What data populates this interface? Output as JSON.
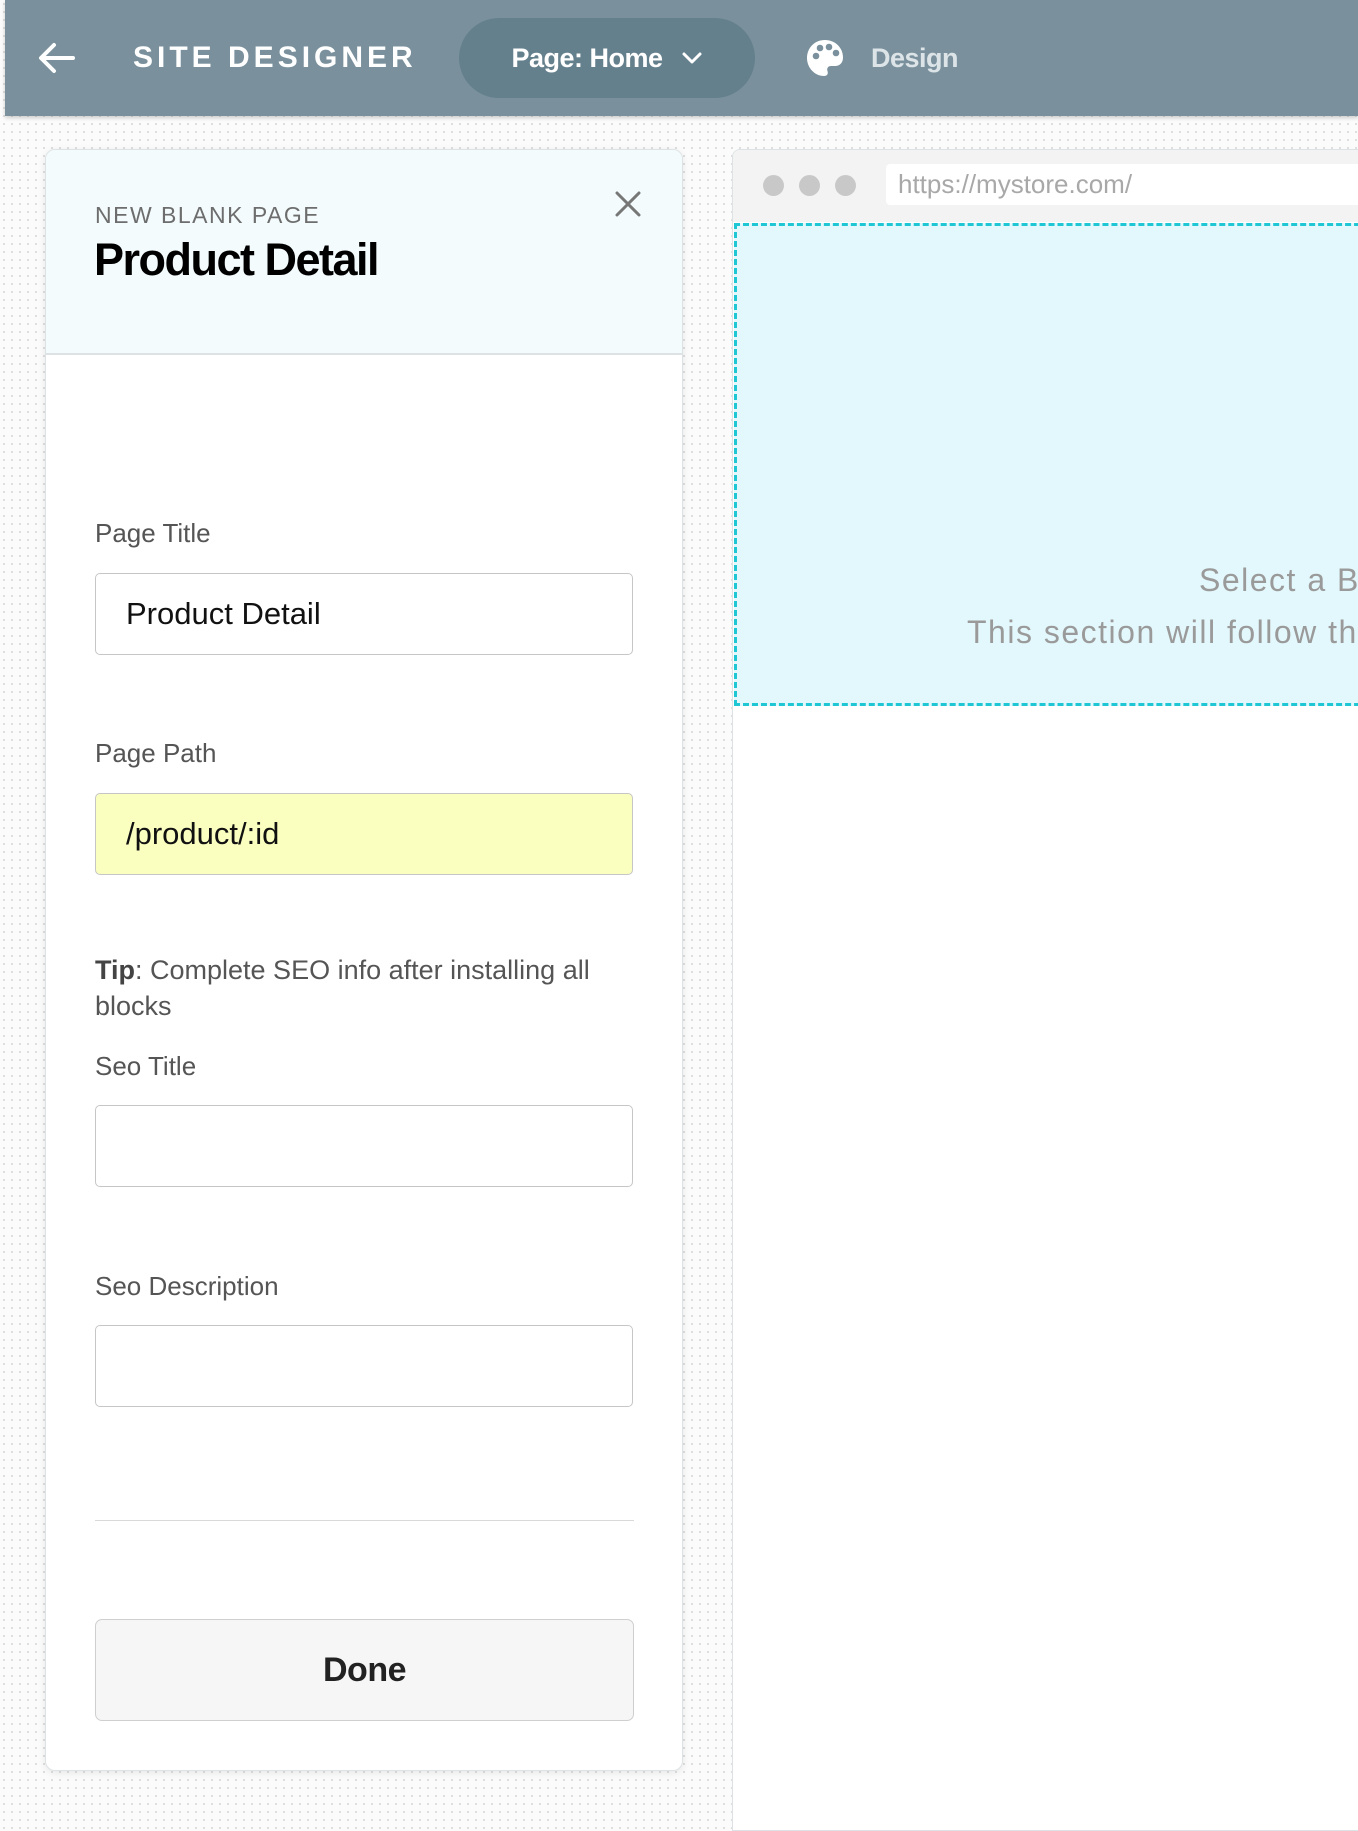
{
  "topbar": {
    "back_icon": "arrow-left-icon",
    "app_title": "SITE DESIGNER",
    "page_selector": "Page: Home",
    "page_selector_icon": "chevron-down-icon",
    "design_label": "Design",
    "design_icon": "palette-icon",
    "background_color": "#7a919d"
  },
  "panel": {
    "subtitle": "NEW BLANK PAGE",
    "title": "Product Detail",
    "close_icon": "close-icon",
    "fields": {
      "page_title": {
        "label": "Page Title",
        "value": "Product Detail"
      },
      "page_path": {
        "label": "Page Path",
        "value": "/product/:id",
        "highlight_color": "#fafebf"
      },
      "seo_title": {
        "label": "Seo Title",
        "value": ""
      },
      "seo_description": {
        "label": "Seo Description",
        "value": ""
      }
    },
    "tip": {
      "label": "Tip",
      "text": ": Complete SEO info after installing all blocks"
    },
    "done_label": "Done"
  },
  "preview": {
    "url": "https://mystore.com/",
    "drop_zone": {
      "line1": "Select a Bl",
      "line2": "This section will follow the",
      "border_color": "#1fc6d3"
    }
  }
}
